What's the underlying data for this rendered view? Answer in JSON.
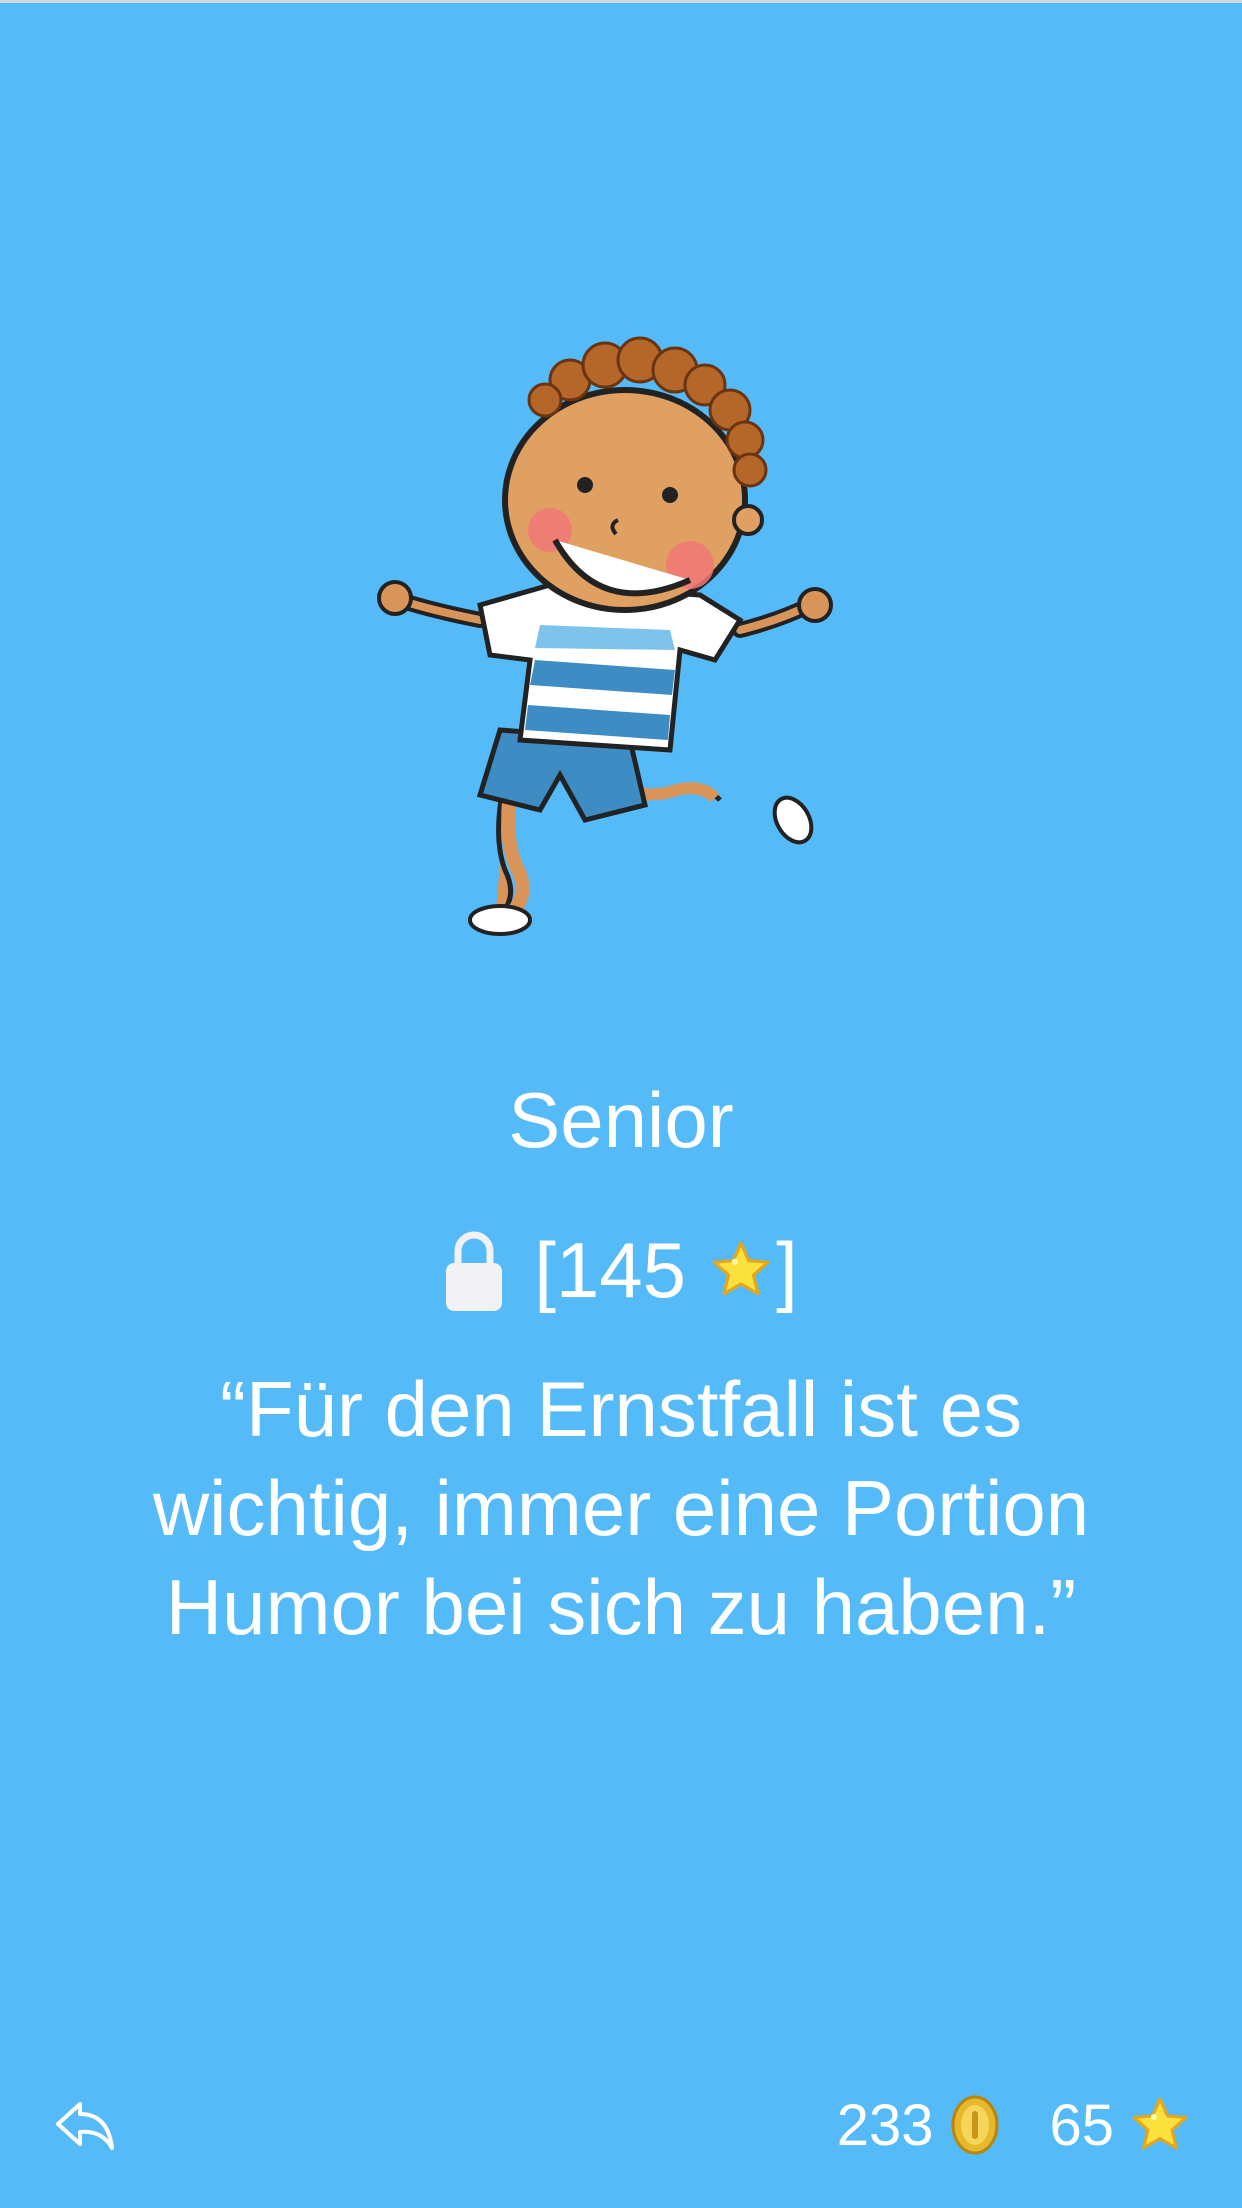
{
  "level": {
    "title": "Senior",
    "lock_open": "[",
    "required_stars": "145",
    "lock_close": "]",
    "quote": "“Für den Ernstfall ist es wichtig, immer eine Portion Humor bei sich zu haben.”"
  },
  "stats": {
    "coins": "233",
    "stars": "65"
  },
  "icons": {
    "back": "reply-arrow-icon",
    "lock": "lock-icon",
    "star": "star-icon",
    "coin": "coin-icon"
  },
  "colors": {
    "background": "#55baf8",
    "text": "#ffffff"
  }
}
